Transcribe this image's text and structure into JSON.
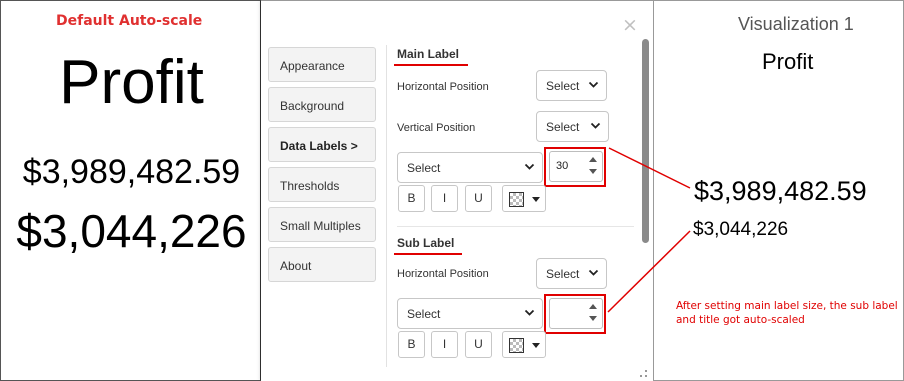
{
  "left_panel": {
    "caption": "Default Auto-scale",
    "title": "Profit",
    "main_value": "$3,989,482.59",
    "sub_value": "$3,044,226"
  },
  "format_pane": {
    "close_label": "×",
    "tabs": [
      {
        "label": "Appearance"
      },
      {
        "label": "Background"
      },
      {
        "label": "Data Labels  >"
      },
      {
        "label": "Thresholds"
      },
      {
        "label": "Small Multiples"
      },
      {
        "label": "About"
      }
    ],
    "active_tab": "Data Labels",
    "main_label": {
      "title": "Main Label",
      "horizontal_position_label": "Horizontal Position",
      "horizontal_position_value": "Select",
      "vertical_position_label": "Vertical Position",
      "vertical_position_value": "Select",
      "font_family_value": "Select",
      "font_size_value": "30",
      "bold_label": "B",
      "italic_label": "I",
      "underline_label": "U"
    },
    "sub_label": {
      "title": "Sub Label",
      "horizontal_position_label": "Horizontal Position",
      "horizontal_position_value": "Select",
      "font_family_value": "Select",
      "font_size_value": "",
      "bold_label": "B",
      "italic_label": "I",
      "underline_label": "U"
    }
  },
  "right_panel": {
    "visualization_name": "Visualization 1",
    "title": "Profit",
    "main_value": "$3,989,482.59",
    "sub_value": "$3,044,226",
    "annotation": "After setting main label size, the sub label and title got auto-scaled"
  },
  "colors": {
    "annotation_red": "#e00000",
    "caption_red": "#e03030",
    "text_black": "#000000",
    "button_bg": "#f3f3f3"
  },
  "icons": [
    "close-icon",
    "chevron-down-icon",
    "stepper-up-icon",
    "stepper-down-icon",
    "color-swatch-icon",
    "resize-grip-icon"
  ]
}
